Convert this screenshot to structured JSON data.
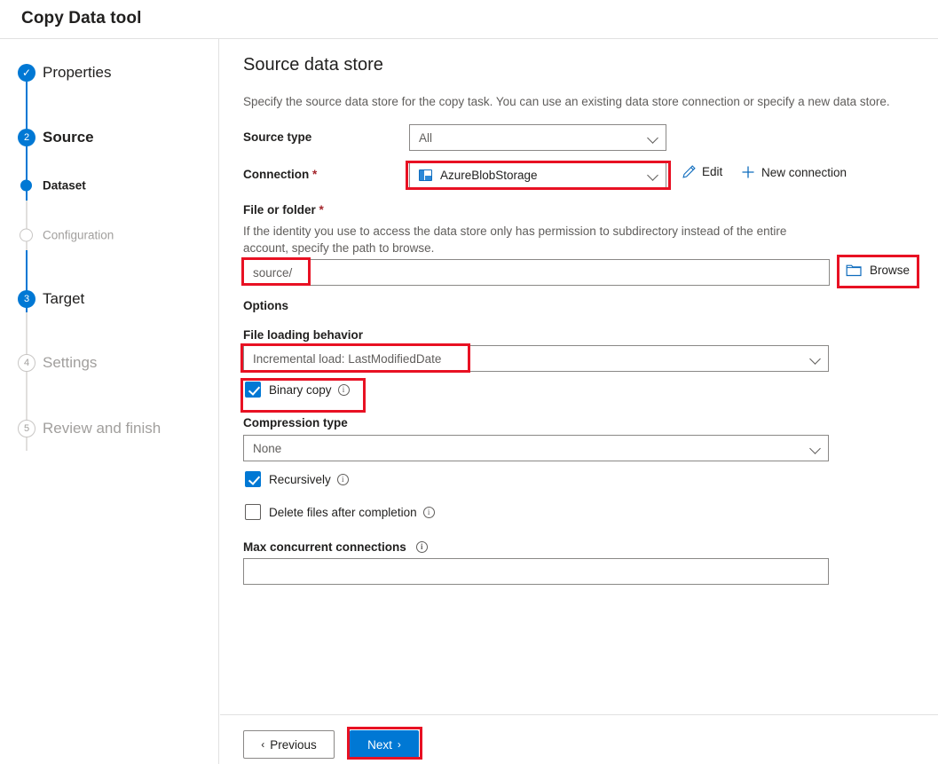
{
  "window": {
    "title": "Copy Data tool"
  },
  "sidebar": {
    "steps": [
      {
        "label": "Properties",
        "marker": "check",
        "marker_text": "✓",
        "state": "completed"
      },
      {
        "label": "Source",
        "marker": "number",
        "marker_text": "2",
        "state": "current"
      },
      {
        "label": "Dataset",
        "marker": "dot",
        "marker_text": "",
        "state": "current-sub"
      },
      {
        "label": "Configuration",
        "marker": "hollow",
        "marker_text": "",
        "state": "disabled-sub"
      },
      {
        "label": "Target",
        "marker": "number",
        "marker_text": "3",
        "state": "upcoming"
      },
      {
        "label": "Settings",
        "marker": "number-muted",
        "marker_text": "4",
        "state": "disabled"
      },
      {
        "label": "Review and finish",
        "marker": "number-muted",
        "marker_text": "5",
        "state": "disabled"
      }
    ]
  },
  "main": {
    "title": "Source data store",
    "description": "Specify the source data store for the copy task. You can use an existing data store connection or specify a new data store.",
    "source_type": {
      "label": "Source type",
      "value": "All"
    },
    "connection": {
      "label": "Connection",
      "required_mark": "*",
      "value": "AzureBlobStorage",
      "edit_label": "Edit",
      "edit_icon": "pencil-icon",
      "new_connection_label": "New connection",
      "new_connection_icon": "plus-icon",
      "icon": "azure-blob-storage-icon"
    },
    "file_or_folder": {
      "label": "File or folder",
      "required_mark": "*",
      "helper": "If the identity you use to access the data store only has permission to subdirectory instead of the entire account, specify the path to browse.",
      "value": "source/",
      "browse_label": "Browse",
      "browse_icon": "folder-icon"
    },
    "options": {
      "header": "Options",
      "file_loading_behavior": {
        "label": "File loading behavior",
        "value": "Incremental load: LastModifiedDate"
      },
      "binary_copy": {
        "label": "Binary copy",
        "checked": true,
        "info_icon": "info-icon"
      },
      "compression_type": {
        "label": "Compression type",
        "value": "None"
      },
      "recursively": {
        "label": "Recursively",
        "checked": true,
        "info_icon": "info-icon"
      },
      "delete_files": {
        "label": "Delete files after completion",
        "checked": false,
        "info_icon": "info-icon"
      },
      "max_concurrent_connections": {
        "label": "Max concurrent connections",
        "value": "",
        "info_icon": "info-icon"
      }
    }
  },
  "footer": {
    "previous_label": "Previous",
    "previous_arrow": "‹",
    "next_label": "Next",
    "next_arrow": "›"
  },
  "colors": {
    "accent": "#0078d4",
    "highlight": "#e81123",
    "required": "#a4262c",
    "muted_text": "#605e5c",
    "disabled_text": "#a19f9d"
  }
}
